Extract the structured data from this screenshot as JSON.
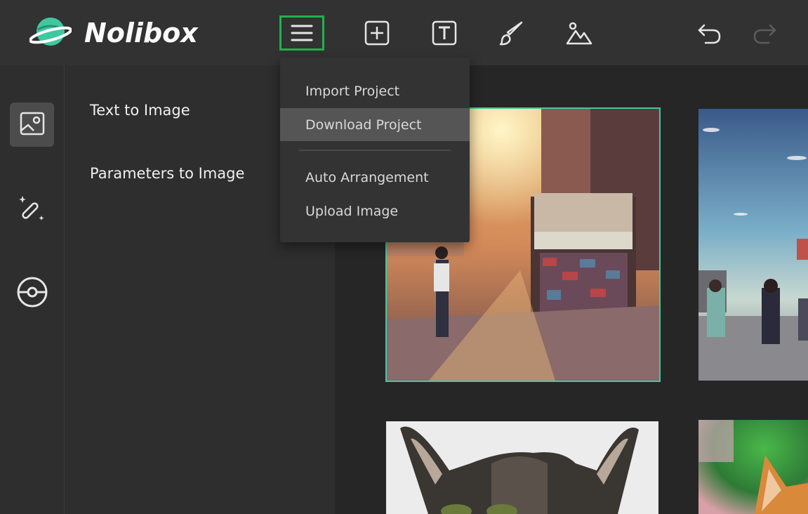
{
  "app": {
    "name": "Nolibox",
    "accent_color": "#3fc8a0",
    "highlight_color": "#22b14c"
  },
  "toolbar": {
    "buttons": [
      {
        "icon": "hamburger-menu-icon",
        "active": true
      },
      {
        "icon": "add-square-icon"
      },
      {
        "icon": "text-square-icon"
      },
      {
        "icon": "brush-icon"
      },
      {
        "icon": "image-mountain-icon"
      },
      {
        "icon": "undo-icon"
      },
      {
        "icon": "redo-icon",
        "disabled": true
      }
    ]
  },
  "menu": {
    "items": [
      {
        "label": "Import Project"
      },
      {
        "label": "Download Project",
        "hovered": true
      },
      {
        "label": "Auto Arrangement"
      },
      {
        "label": "Upload Image"
      }
    ]
  },
  "rail": {
    "items": [
      {
        "icon": "image-icon",
        "selected": true
      },
      {
        "icon": "magic-wand-icon"
      },
      {
        "icon": "circle-target-icon"
      }
    ]
  },
  "panel": {
    "items": [
      {
        "label": "Text to Image"
      },
      {
        "label": "Parameters to Image"
      }
    ]
  },
  "canvas": {
    "thumbnails": [
      {
        "icon": "street-market-sunset-image",
        "selected": true
      },
      {
        "icon": "anime-street-image"
      },
      {
        "icon": "cat-closeup-image"
      },
      {
        "icon": "orange-cat-image"
      }
    ]
  }
}
